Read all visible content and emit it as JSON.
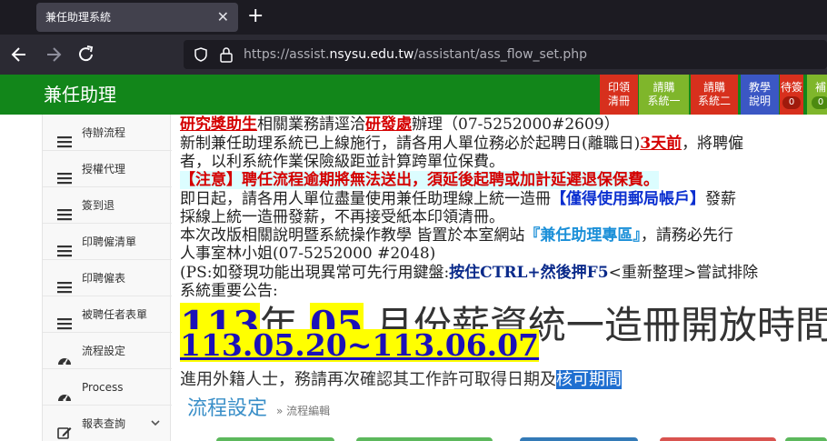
{
  "browser": {
    "tab_title": "兼任助理系統",
    "tab_close": "✕",
    "new_tab": "+",
    "url_prefix": "https://assist.",
    "url_domain": "nsysu.edu.tw",
    "url_path": "/assistant/ass_flow_set.php"
  },
  "header": {
    "brand": "兼任助理",
    "buttons": [
      {
        "line1": "印領",
        "line2": "清冊",
        "color": "#d7301d"
      },
      {
        "line1": "請購",
        "line2": "系統一",
        "color": "#7fb62b"
      },
      {
        "line1": "請購",
        "line2": "系統二",
        "color": "#d7301d"
      },
      {
        "line1": "教學",
        "line2": "說明",
        "color": "#3b57c4"
      },
      {
        "line1": "待簽",
        "count": "0",
        "color": "#d7301d"
      },
      {
        "line1": "補",
        "count": "0",
        "color": "#7fb62b"
      }
    ]
  },
  "sidebar": {
    "items": [
      {
        "label": "待辦流程",
        "icon": "menu-icon"
      },
      {
        "label": "授權代理",
        "icon": "menu-icon"
      },
      {
        "label": "簽到退",
        "icon": "menu-icon"
      },
      {
        "label": "印聘僱清單",
        "icon": "menu-icon"
      },
      {
        "label": "印聘僱表",
        "icon": "menu-icon"
      },
      {
        "label": "被聘任者表單",
        "icon": "menu-icon"
      },
      {
        "label": "流程設定",
        "icon": "dashboard-icon"
      },
      {
        "label": "Process",
        "icon": "dashboard-icon"
      },
      {
        "label": "報表查詢",
        "icon": "edit-icon"
      }
    ]
  },
  "announcement": {
    "l1_a": "研究獎助生",
    "l1_b": "相關業務請逕洽",
    "l1_c": "研發處",
    "l1_d": "辦理（07-5252000#2609）",
    "l2_a": "新制兼任助理系統已上線施行，請各用人單位務必於起聘日(離職日)",
    "l2_b": "3天前",
    "l2_c": "，將聘僱",
    "l3": "者，以利系統作業保險級距並計算跨單位保費。",
    "l4": "【注意】聘任流程逾期將無法送出，須延後起聘或加計延遲退保保費。",
    "l5_a": "即日起，請各用人單位盡量使用兼任助理線上統一造冊",
    "l5_b": "【僅得使用郵局帳戶】",
    "l5_c": "發薪",
    "l6": "採線上統一造冊發薪，不再接受紙本印領清冊。",
    "l7_a": "本次改版相關說明暨系統操作教學 皆置於本室網站",
    "l7_b": "『兼任助理專區』",
    "l7_c": "，請務必先行",
    "l8": "人事室林小姐(07-5252000 #2048)",
    "l9_a": "(PS:如發現功能出現異常可先行用鍵盤:",
    "l9_b": "按住CTRL+然後押F5",
    "l9_c": "<重新整理>嘗試排除",
    "l10": "系統重要公告:",
    "big_year": "113",
    "big_year_unit": "年",
    "big_month": "05",
    "big_rest": "月份薪資統一造冊開放時間為",
    "big_range": "113.05.20~113.06.07",
    "note_a": "進用外籍人士，務請再次確認其工作許可取得日期及",
    "note_b": "核可期間"
  },
  "page": {
    "title": "流程設定",
    "breadcrumb": "» 流程編輯"
  }
}
